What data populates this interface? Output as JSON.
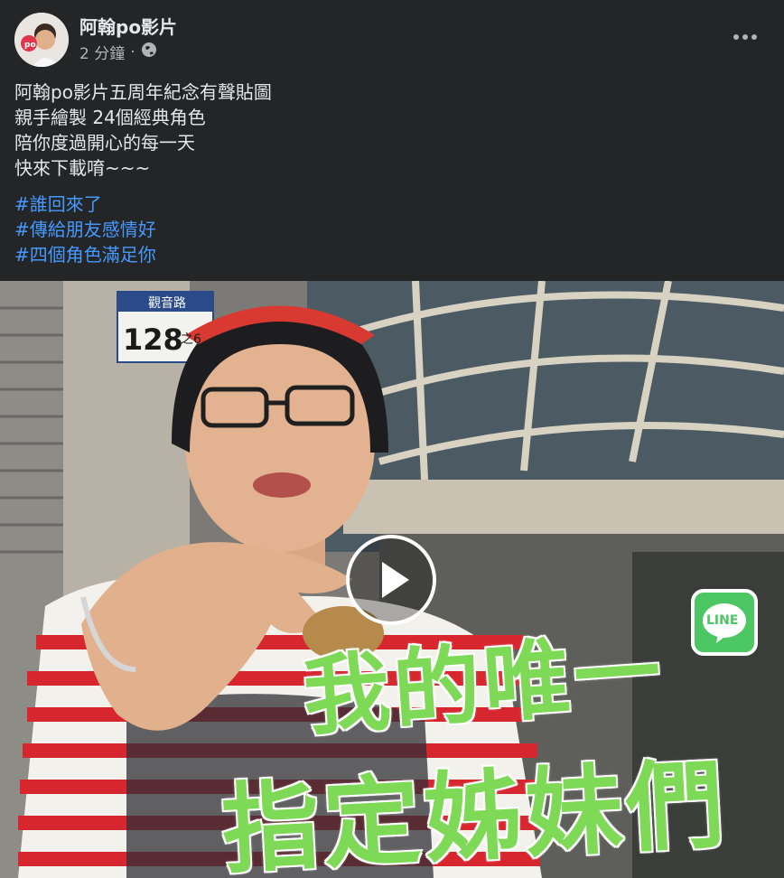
{
  "post": {
    "author": "阿翰po影片",
    "time": "2 分鐘",
    "separator": "·",
    "privacy_icon": "globe-icon",
    "more_icon": "more-dots-icon",
    "text_lines": [
      "阿翰po影片五周年紀念有聲貼圖",
      "親手繪製 24個經典角色",
      "陪你度過開心的每一天",
      "快來下載唷~~~"
    ],
    "hashtags": [
      "#誰回來了",
      "#傳給朋友感情好",
      "#四個角色滿足你"
    ]
  },
  "video": {
    "play_icon": "play-icon",
    "address_plate_number": "128",
    "address_plate_sub": "之6",
    "address_plate_street": "觀音路",
    "line_badge_text": "LINE",
    "overlay_line1": "我的唯一",
    "overlay_line2": "指定姊妹們"
  },
  "colors": {
    "background": "#242526",
    "text_primary": "#e4e6eb",
    "text_secondary": "#b0b3b8",
    "hashtag": "#4599ff",
    "overlay_green": "#7ed957",
    "line_green": "#4cc764"
  }
}
